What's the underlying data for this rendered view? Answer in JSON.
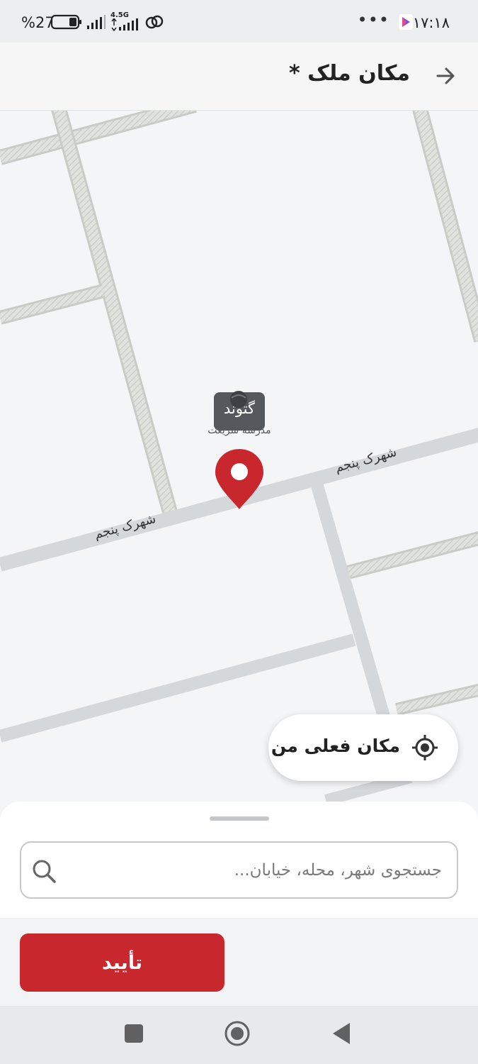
{
  "status_bar": {
    "time": "۱۷:۱۸",
    "battery_percent": "%27",
    "network_type": "4.5G",
    "icons": [
      "more-dots-icon",
      "app-notification-icon",
      "battery-icon",
      "signal-icon",
      "network-signal-icon",
      "hotspot-icon"
    ]
  },
  "header": {
    "title": "مکان ملک *",
    "back_icon": "arrow-right-icon"
  },
  "map": {
    "street_labels": [
      "شهرک پنجم",
      "شهرک پنجم"
    ],
    "poi": {
      "name": "گتوند",
      "subtitle": "مدرسه شریعت"
    },
    "pin_icon": "location-pin-icon",
    "pin_color": "#c8272d",
    "my_location_button": {
      "label": "مکان فعلی من",
      "icon": "crosshair-icon"
    }
  },
  "bottom_sheet": {
    "search": {
      "placeholder": "جستجوی شهر، محله، خیابان...",
      "value": "",
      "icon": "search-icon"
    },
    "confirm_label": "تأیید",
    "accent_color": "#c8272d"
  },
  "nav_bar": {
    "icons": [
      "recents-square-icon",
      "home-circle-icon",
      "back-triangle-icon"
    ]
  }
}
